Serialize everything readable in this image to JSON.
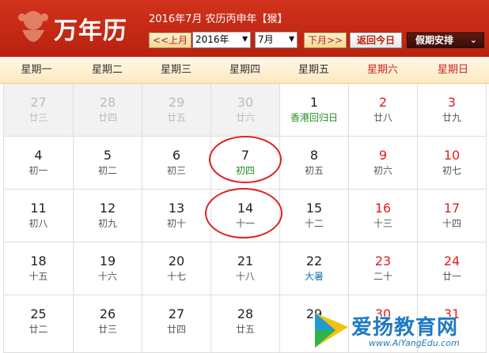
{
  "header": {
    "app_title": "万年历",
    "date_line": "2016年7月  农历丙申年【猴】",
    "prev_month": "<<上月",
    "year_select": "2016年",
    "month_select": "7月",
    "next_month": "下月>>",
    "today_button": "返回今日",
    "holiday_button": "假期安排"
  },
  "weekdays": [
    "星期一",
    "星期二",
    "星期三",
    "星期四",
    "星期五",
    "星期六",
    "星期日"
  ],
  "days": [
    {
      "num": "27",
      "lunar": "廿三",
      "other": true
    },
    {
      "num": "28",
      "lunar": "廿四",
      "other": true
    },
    {
      "num": "29",
      "lunar": "廿五",
      "other": true
    },
    {
      "num": "30",
      "lunar": "廿六",
      "other": true
    },
    {
      "num": "1",
      "lunar": "香港回归日",
      "hl": "green"
    },
    {
      "num": "2",
      "lunar": "廿八"
    },
    {
      "num": "3",
      "lunar": "廿九"
    },
    {
      "num": "4",
      "lunar": "初一"
    },
    {
      "num": "5",
      "lunar": "初二"
    },
    {
      "num": "6",
      "lunar": "初三"
    },
    {
      "num": "7",
      "lunar": "初四",
      "hl": "green"
    },
    {
      "num": "8",
      "lunar": "初五"
    },
    {
      "num": "9",
      "lunar": "初六"
    },
    {
      "num": "10",
      "lunar": "初七"
    },
    {
      "num": "11",
      "lunar": "初八"
    },
    {
      "num": "12",
      "lunar": "初九"
    },
    {
      "num": "13",
      "lunar": "初十"
    },
    {
      "num": "14",
      "lunar": "十一"
    },
    {
      "num": "15",
      "lunar": "十二"
    },
    {
      "num": "16",
      "lunar": "十三"
    },
    {
      "num": "17",
      "lunar": "十四"
    },
    {
      "num": "18",
      "lunar": "十五"
    },
    {
      "num": "19",
      "lunar": "十六"
    },
    {
      "num": "20",
      "lunar": "十七"
    },
    {
      "num": "21",
      "lunar": "十八"
    },
    {
      "num": "22",
      "lunar": "大暑",
      "hl": "blue"
    },
    {
      "num": "23",
      "lunar": "二十"
    },
    {
      "num": "24",
      "lunar": "廿一"
    },
    {
      "num": "25",
      "lunar": "廿二"
    },
    {
      "num": "26",
      "lunar": "廿三"
    },
    {
      "num": "27",
      "lunar": "廿四"
    },
    {
      "num": "28",
      "lunar": "廿五"
    },
    {
      "num": "29",
      "lunar": ""
    },
    {
      "num": "30",
      "lunar": ""
    },
    {
      "num": "31",
      "lunar": ""
    }
  ],
  "watermark": {
    "text": "爱扬教育网",
    "url": "www.AiYangEdu.com"
  }
}
